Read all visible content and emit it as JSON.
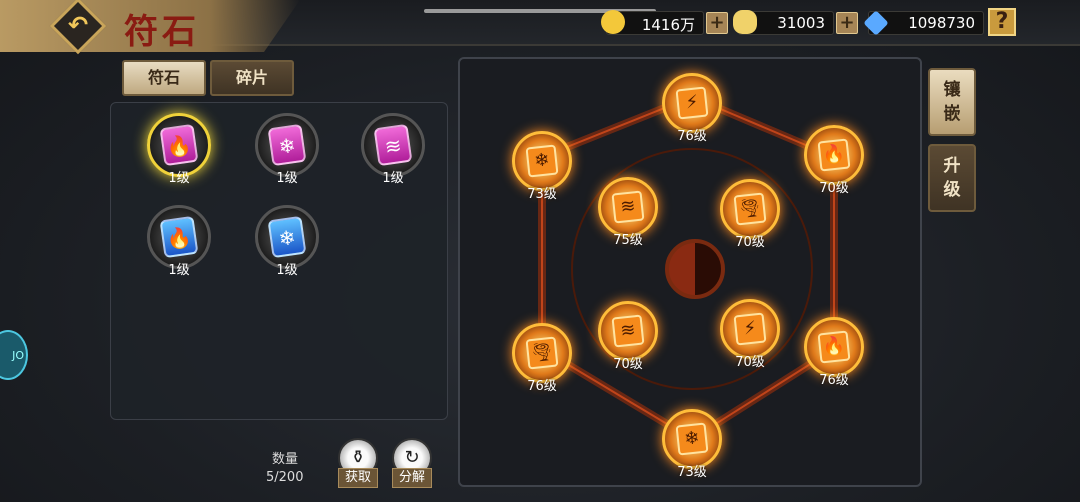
{
  "header": {
    "title": "符石"
  },
  "resources": [
    {
      "name": "gold",
      "value": "1416万",
      "color": "#f3c83a"
    },
    {
      "name": "ingot",
      "value": "31003",
      "color": "#f0d26a"
    },
    {
      "name": "crystal",
      "value": "1098730",
      "color": "#5aa9ff"
    }
  ],
  "help_label": "?",
  "tabs": [
    {
      "label": "符石",
      "active": true
    },
    {
      "label": "碎片",
      "active": false
    }
  ],
  "inventory": [
    {
      "icon": "fire-rune-icon",
      "glyph": "🔥",
      "color": "pink",
      "label": "1级",
      "selected": true
    },
    {
      "icon": "snowflake-rune-icon",
      "glyph": "❄",
      "color": "pink",
      "label": "1级",
      "selected": false
    },
    {
      "icon": "claw-rune-icon",
      "glyph": "≋",
      "color": "pink",
      "label": "1级",
      "selected": false
    },
    {
      "icon": "fire-rune-icon",
      "glyph": "🔥",
      "color": "blue",
      "label": "1级",
      "selected": false
    },
    {
      "icon": "snowflake-rune-icon",
      "glyph": "❄",
      "color": "blue",
      "label": "1级",
      "selected": false
    }
  ],
  "quantity": {
    "label": "数量",
    "value": "5/200"
  },
  "actions": {
    "obtain": "获取",
    "decompose": "分解"
  },
  "side_buttons": {
    "inlay": "镶\n嵌",
    "upgrade": "升\n级"
  },
  "board_nodes": [
    {
      "glyph": "⚡",
      "label": "76级",
      "icon": "lightning-rune-icon"
    },
    {
      "glyph": "❄",
      "label": "73级",
      "icon": "snowflake-rune-icon"
    },
    {
      "glyph": "🔥",
      "label": "70级",
      "icon": "fire-rune-icon"
    },
    {
      "glyph": "≋",
      "label": "75级",
      "icon": "claw-rune-icon"
    },
    {
      "glyph": "🌪",
      "label": "70级",
      "icon": "tornado-rune-icon"
    },
    {
      "glyph": "🌪",
      "label": "76级",
      "icon": "tornado-rune-icon"
    },
    {
      "glyph": "≋",
      "label": "70级",
      "icon": "claw-rune-icon"
    },
    {
      "glyph": "⚡",
      "label": "70级",
      "icon": "lightning-rune-icon"
    },
    {
      "glyph": "🔥",
      "label": "76级",
      "icon": "fire-rune-icon"
    },
    {
      "glyph": "❄",
      "label": "73级",
      "icon": "snowflake-rune-icon"
    }
  ]
}
